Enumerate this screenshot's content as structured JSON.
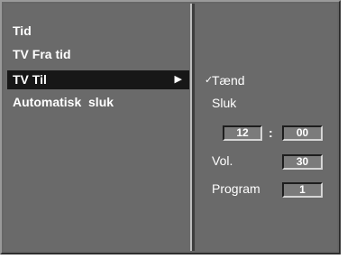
{
  "menu": {
    "items": [
      {
        "label": "Tid"
      },
      {
        "label": "TV Fra tid"
      },
      {
        "label": "TV Til",
        "arrow": "▶"
      },
      {
        "label": "Automatisk  sluk"
      }
    ],
    "selected_index": 2
  },
  "submenu": {
    "check_mark": "✓",
    "options": [
      "Tænd",
      "Sluk"
    ],
    "selected_option": "Tænd",
    "time": {
      "hour": "12",
      "separator": ":",
      "minute": "00"
    },
    "volume": {
      "label": "Vol.",
      "value": "30"
    },
    "program": {
      "label": "Program",
      "value": "1"
    }
  },
  "colors": {
    "panel": "#6a6a6a",
    "highlight": "#171717",
    "text": "#ffffff"
  }
}
